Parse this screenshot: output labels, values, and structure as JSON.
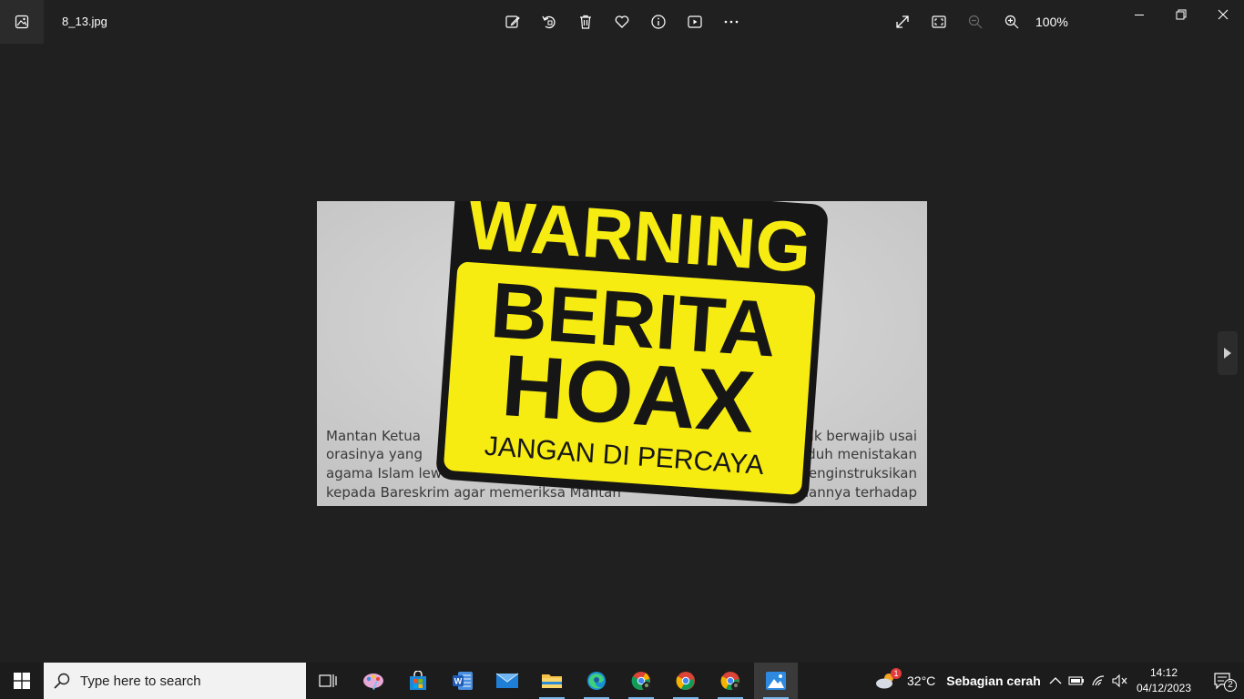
{
  "window": {
    "filename": "8_13.jpg",
    "zoom": "100%"
  },
  "toolbar": {
    "icons": [
      "edit-icon",
      "rotate-icon",
      "delete-icon",
      "favorite-icon",
      "info-icon",
      "slideshow-icon",
      "more-icon"
    ],
    "right_icons": [
      "full-screen-icon",
      "fit-icon",
      "zoom-out-icon",
      "zoom-in-icon"
    ]
  },
  "image": {
    "sign_top": "WARNING",
    "sign_line1": "BERITA",
    "sign_line2": "HOAX",
    "sign_bottom": "JANGAN DI PERCAYA",
    "bg_text": [
      "Mantan Ketua",
      "nak berwajib usai",
      "orasinya yang",
      "tuduh menistakan",
      "agama Islam lewat",
      "menginstruksikan",
      "kepada Bareskrim agar memeriksa Mantan",
      "uhannya terhadap"
    ],
    "colors": {
      "sign_yellow": "#f7ec12",
      "sign_black": "#161616"
    }
  },
  "taskbar": {
    "search_placeholder": "Type here to search",
    "weather_temp": "32°C",
    "weather_desc": "Sebagian cerah",
    "weather_badge": "1",
    "time": "14:12",
    "date": "04/12/2023",
    "notification_count": "2",
    "apps": [
      "task-view",
      "paint-3d",
      "microsoft-store",
      "word",
      "mail",
      "file-explorer",
      "edge",
      "chrome-profile",
      "chrome",
      "chrome-profile-2",
      "photos"
    ]
  }
}
